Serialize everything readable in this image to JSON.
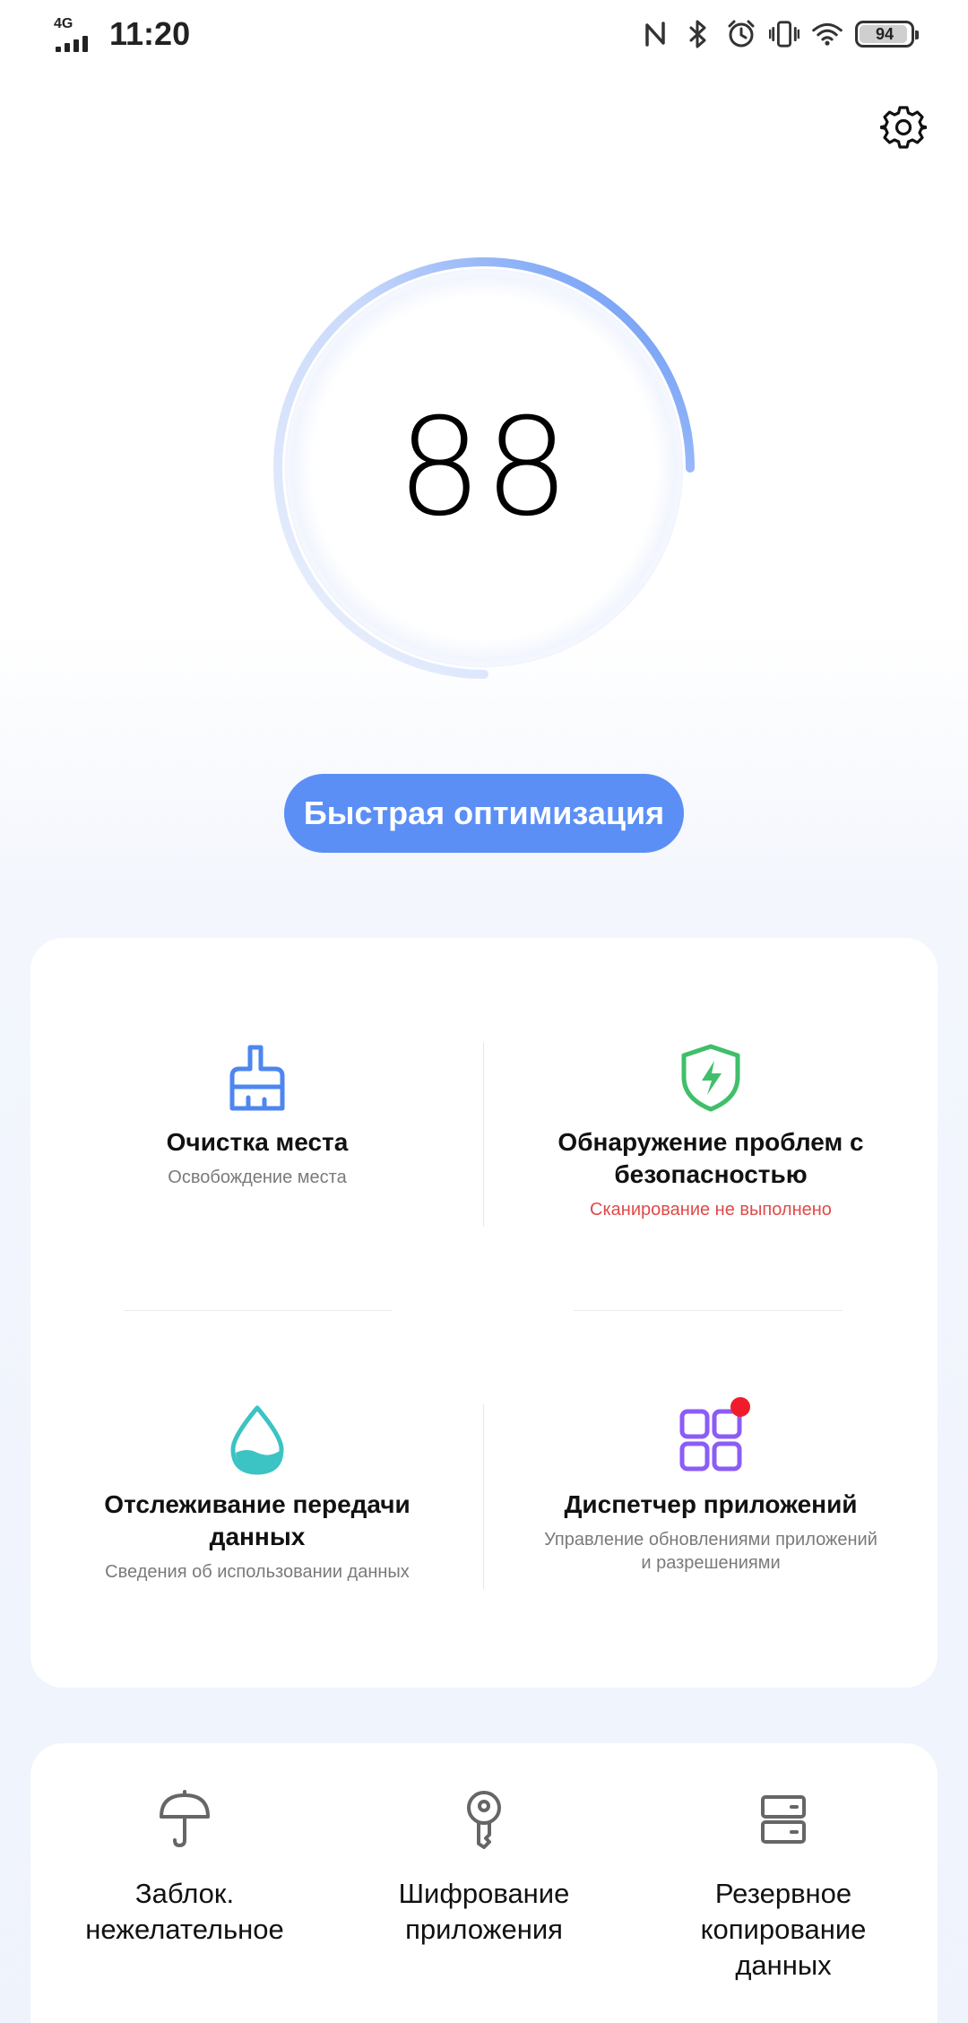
{
  "status_bar": {
    "network": "4G",
    "time": "11:20",
    "battery": "94",
    "battery_level": 0.94,
    "icons": [
      "nfc-icon",
      "bluetooth-icon",
      "alarm-icon",
      "vibrate-icon",
      "wifi-icon",
      "battery-icon"
    ]
  },
  "score": {
    "value": "88",
    "progress": 0.88
  },
  "optimize_button": {
    "label": "Быстрая оптимизация"
  },
  "features": [
    {
      "title": "Очистка места",
      "subtitle": "Освобождение места",
      "icon": "broom-icon",
      "color": "#4d86f0"
    },
    {
      "title": "Обнаружение проблем с безопасностью",
      "subtitle": "Сканирование не выполнено",
      "icon": "shield-bolt-icon",
      "color": "#3fbf6a",
      "subtitle_color": "#e04a4a"
    },
    {
      "title": "Отслеживание передачи данных",
      "subtitle": "Сведения об использовании данных",
      "icon": "water-drop-icon",
      "color": "#3cc3c3"
    },
    {
      "title": "Диспетчер приложений",
      "subtitle": "Управление обновлениями приложений и разрешениями",
      "icon": "app-grid-icon",
      "color": "#8b5cf6",
      "badge": true
    }
  ],
  "tools": [
    {
      "label": "Заблок. нежелательное",
      "icon": "umbrella-icon"
    },
    {
      "label": "Шифрование приложения",
      "icon": "key-icon"
    },
    {
      "label": "Резервное копирование данных",
      "icon": "server-icon"
    }
  ],
  "colors": {
    "accent": "#5b8ff5",
    "ring_start": "#dbe6fb",
    "ring_end": "#5b8ff5"
  }
}
